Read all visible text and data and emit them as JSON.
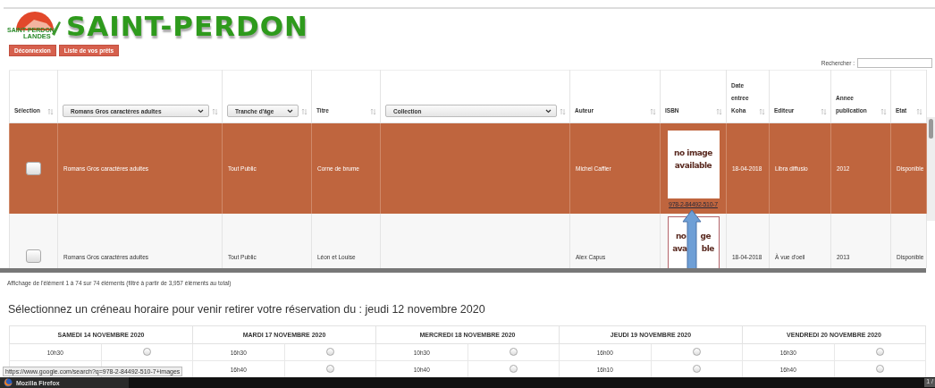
{
  "logo": {
    "text": "SAINT PERDON",
    "subtext": "LANDES"
  },
  "site_title": "SAINT-PERDON",
  "buttons": [
    "Déconnexion",
    "Liste de vos prêts"
  ],
  "search": {
    "label": "Rechercher :"
  },
  "table": {
    "columns": [
      {
        "kind": "text",
        "lines": [
          "Sélection"
        ]
      },
      {
        "kind": "filter",
        "value": "Romans Gros caractères adultes"
      },
      {
        "kind": "filter",
        "value": "Tranche d'âge"
      },
      {
        "kind": "text",
        "lines": [
          "Titre"
        ]
      },
      {
        "kind": "filter",
        "value": "Collection"
      },
      {
        "kind": "text",
        "lines": [
          "Auteur"
        ]
      },
      {
        "kind": "text",
        "lines": [
          "ISBN"
        ]
      },
      {
        "kind": "text",
        "lines": [
          "Date",
          "entree",
          "Koha"
        ]
      },
      {
        "kind": "text",
        "lines": [
          "Editeur"
        ]
      },
      {
        "kind": "text",
        "lines": [
          "Annee",
          "publication"
        ]
      },
      {
        "kind": "text",
        "lines": [
          "Etat"
        ]
      }
    ],
    "rows": [
      {
        "selected": true,
        "checked": false,
        "genre": "Romans Gros caractères adultes",
        "age": "Tout Public",
        "title": "Corne de brume",
        "author": "Michel Caffier",
        "cover": [
          [
            "no image"
          ],
          [
            "available"
          ]
        ],
        "isbn": "978-2-84492-510-7",
        "date": "18-04-2018",
        "publisher": "Libra diffusio",
        "year": "2012",
        "status": "Disponible"
      },
      {
        "selected": false,
        "checked": false,
        "genre": "Romans Gros caractères adultes",
        "age": "Tout Public",
        "title": "Léon et Louise",
        "author": "Alex Capus",
        "cover": [
          [
            "no",
            "ge"
          ],
          [
            "ava",
            "ble"
          ]
        ],
        "date": "18-04-2018",
        "publisher": "À vue d'oeil",
        "year": "2013",
        "status": "Disponible"
      }
    ]
  },
  "table_info": "Affichage de l'élément 1 à 74 sur 74 éléments (filtré à partir de 3,957 éléments au total)",
  "slots_heading": "Sélectionnez un créneau horaire pour venir retirer votre réservation du : jeudi 12 novembre 2020",
  "days": [
    {
      "label": "SAMEDI 14 NOVEMBRE 2020",
      "slots": [
        {
          "time": "10h30",
          "selected": false
        }
      ]
    },
    {
      "label": "MARDI 17 NOVEMBRE 2020",
      "slots": [
        {
          "time": "16h30",
          "selected": false
        },
        {
          "time": "16h40",
          "selected": false
        }
      ]
    },
    {
      "label": "MERCREDI 18 NOVEMBRE 2020",
      "slots": [
        {
          "time": "10h30",
          "selected": false
        },
        {
          "time": "10h40",
          "selected": false
        }
      ]
    },
    {
      "label": "JEUDI 19 NOVEMBRE 2020",
      "slots": [
        {
          "time": "16h00",
          "selected": false
        },
        {
          "time": "16h10",
          "selected": false
        }
      ]
    },
    {
      "label": "VENDREDI 20 NOVEMBRE 2020",
      "slots": [
        {
          "time": "16h30",
          "selected": false
        },
        {
          "time": "16h40",
          "selected": false
        }
      ]
    }
  ],
  "status_url": "https://www.google.com/search?q=978-2-84492-510-7+images",
  "taskbar": {
    "app": "Mozilla Firefox",
    "page": "1 /"
  }
}
